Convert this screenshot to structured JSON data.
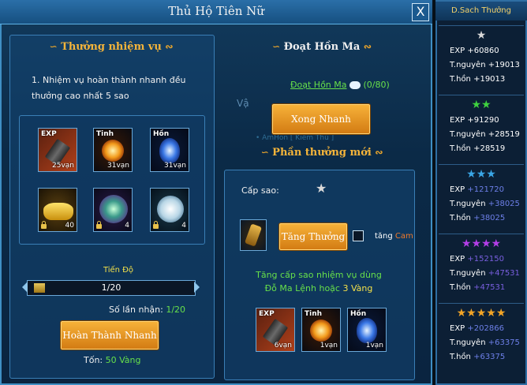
{
  "window": {
    "title": "Thủ Hộ Tiên Nữ",
    "close_label": "X"
  },
  "left": {
    "header": "Thưởng nhiệm vụ",
    "description": "1. Nhiệm vụ hoàn thành nhanh đều thưởng cao nhất 5 sao",
    "rewards": [
      {
        "label": "EXP",
        "count": "25vạn",
        "icon": "exp-scroll-icon",
        "locked": false
      },
      {
        "label": "Tinh",
        "count": "31vạn",
        "icon": "tinh-orb-icon",
        "locked": false
      },
      {
        "label": "Hồn",
        "count": "31vạn",
        "icon": "hon-flame-icon",
        "locked": false
      },
      {
        "label": "",
        "count": "40",
        "icon": "gold-ingot-icon",
        "locked": true
      },
      {
        "label": "",
        "count": "4",
        "icon": "green-gem-icon",
        "locked": true
      },
      {
        "label": "",
        "count": "4",
        "icon": "white-pearl-icon",
        "locked": true
      }
    ],
    "progress_label": "Tiến Độ",
    "progress_text": "1/20",
    "progress_fraction": 0.05,
    "times_label": "Số lần nhận:",
    "times_value": "1/20",
    "complete_button": "Hoàn Thành Nhanh",
    "cost_label": "Tốn:",
    "cost_value": "50 Vàng"
  },
  "right": {
    "header": "Đoạt Hồn Ma",
    "task_link": "Đoạt Hồn Ma",
    "task_count": "(0/80)",
    "xong_button": "Xong Nhanh",
    "new_reward_header": "Phần thưởng mới",
    "star_level_label": "Cấp sao:",
    "increase_button": "Tăng Thưởng",
    "checkbox_label": "tăng",
    "checkbox_value": "Cam",
    "info_line1": "Tăng cấp sao nhiệm vụ dùng",
    "info_line2_a": "Đỗ Ma Lệnh hoặc",
    "info_line2_b": "3 Vàng",
    "rewards": [
      {
        "label": "EXP",
        "count": "6vạn",
        "icon": "exp-scroll-icon"
      },
      {
        "label": "Tinh",
        "count": "1vạn",
        "icon": "tinh-orb-icon"
      },
      {
        "label": "Hồn",
        "count": "1vạn",
        "icon": "hon-flame-icon"
      }
    ],
    "bg_fragment_1": "Vậ",
    "bg_fragment_2": "• AmHon [ Kiếm Thú ]"
  },
  "sidebar": {
    "title": "D.Sach Thưởng",
    "tiers": [
      {
        "stars": 1,
        "star_color": "#d9d9d9",
        "exp": "+60860",
        "nguyen": "+19013",
        "hon": "+19013",
        "value_color": "#ffffff"
      },
      {
        "stars": 2,
        "star_color": "#3fd13f",
        "exp": "+91290",
        "nguyen": "+28519",
        "hon": "+28519",
        "value_color": "#ffffff"
      },
      {
        "stars": 3,
        "star_color": "#3aa6e6",
        "exp": "+121720",
        "nguyen": "+38025",
        "hon": "+38025",
        "value_color": "#6d7fe8"
      },
      {
        "stars": 4,
        "star_color": "#b23ee6",
        "exp": "+152150",
        "nguyen": "+47531",
        "hon": "+47531",
        "value_color": "#7a5fe0"
      },
      {
        "stars": 5,
        "star_color": "#f2a426",
        "exp": "+202866",
        "nguyen": "+63375",
        "hon": "+63375",
        "value_color": "#6d7fe8"
      }
    ],
    "labels": {
      "exp": "EXP",
      "nguyen": "T.nguyên",
      "hon": "T.hồn"
    }
  }
}
